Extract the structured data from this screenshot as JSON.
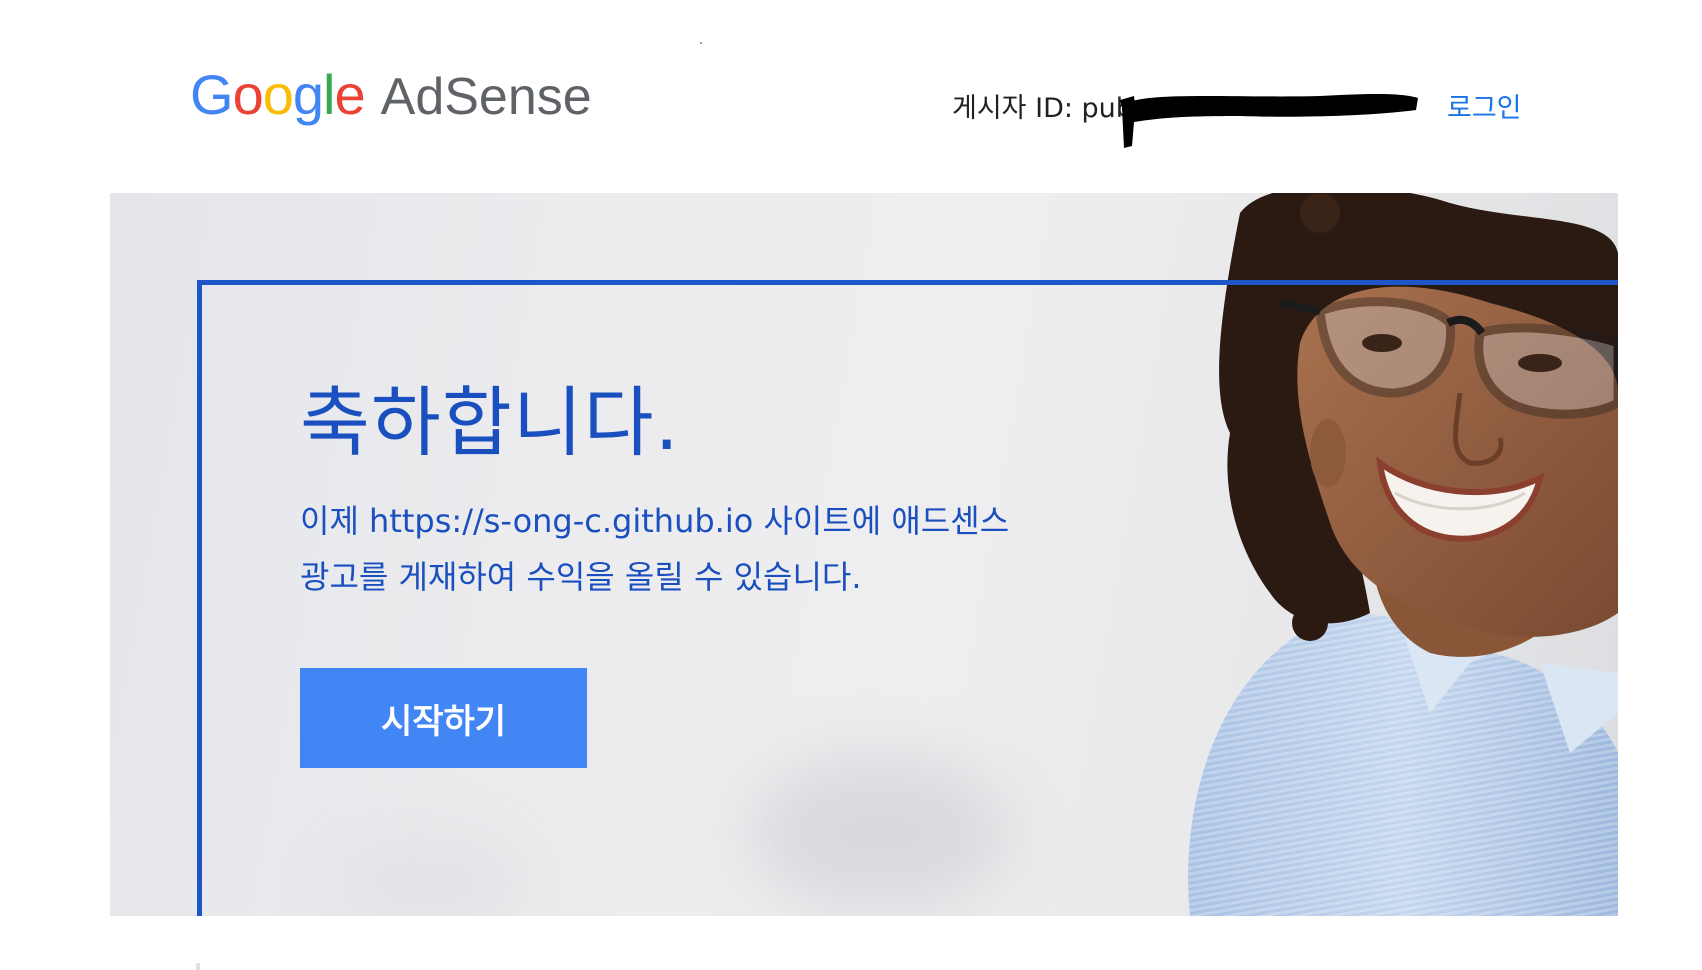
{
  "header": {
    "logo": {
      "google_letters": [
        {
          "char": "G",
          "color": "#4285F4"
        },
        {
          "char": "o",
          "color": "#EA4335"
        },
        {
          "char": "o",
          "color": "#FBBC05"
        },
        {
          "char": "g",
          "color": "#4285F4"
        },
        {
          "char": "l",
          "color": "#34A853"
        },
        {
          "char": "e",
          "color": "#EA4335"
        }
      ],
      "product": "AdSense"
    },
    "publisher_label": "게시자 ID: pub-",
    "login_label": "로그인"
  },
  "hero": {
    "title": "축하합니다.",
    "description": "이제 https://s-ong-c.github.io 사이트에 애드센스 광고를 게재하여 수익을 올릴 수 있습니다.",
    "button_label": "시작하기",
    "image": "smiling-woman-with-glasses-photo"
  },
  "colors": {
    "accent_blue": "#1a4fbf",
    "frame_blue": "#1d56c9",
    "button_blue": "#4285f4",
    "link_blue": "#1a73e8"
  }
}
